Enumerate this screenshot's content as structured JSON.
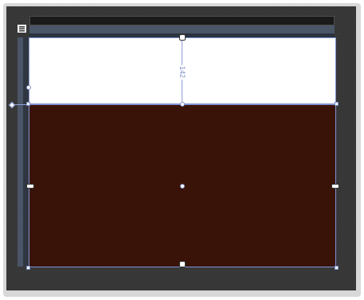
{
  "designer": {
    "grid_icon": "grid-layout-icon",
    "row_height_label": "142",
    "colors": {
      "canvas": "#3a3a3a",
      "top_row": "#ffffff",
      "bottom_row": "#3a1308",
      "selection": "#7f93d6"
    }
  }
}
